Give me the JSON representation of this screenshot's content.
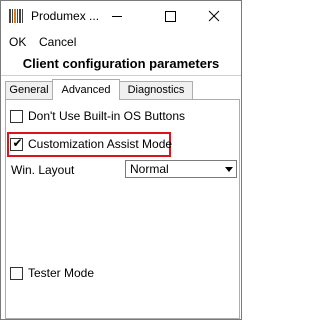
{
  "window": {
    "title": "Produmex ...",
    "controls": {
      "minimize": "minimize-icon",
      "maximize": "maximize-icon",
      "close": "close-icon"
    }
  },
  "menu": {
    "ok": "OK",
    "cancel": "Cancel"
  },
  "header": {
    "title": "Client configuration parameters"
  },
  "tabs": [
    {
      "label": "General",
      "active": false
    },
    {
      "label": "Advanced",
      "active": true
    },
    {
      "label": "Diagnostics",
      "active": false
    }
  ],
  "advanced": {
    "dont_use_builtin_os_buttons": {
      "label": "Don't Use Built-in OS Buttons",
      "checked": false
    },
    "customization_assist_mode": {
      "label": "Customization Assist Mode",
      "checked": true,
      "highlighted": true
    },
    "win_layout": {
      "label": "Win. Layout",
      "value": "Normal"
    },
    "tester_mode": {
      "label": "Tester Mode",
      "checked": false
    }
  },
  "colors": {
    "highlight": "#d9141c",
    "border": "#adadad"
  }
}
